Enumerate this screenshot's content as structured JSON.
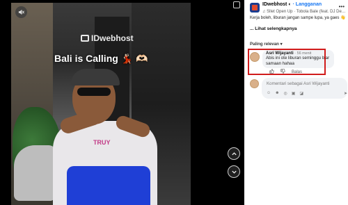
{
  "video": {
    "watermark": "IDwebhost",
    "caption": "Bali is Calling 💃🏻 🫶🏻",
    "shirt_print": "TRUY"
  },
  "controls": {
    "mute_icon": "volume-mute-icon",
    "prev_icon": "chevron-up-icon",
    "next_icon": "chevron-down-icon",
    "collapse_icon": "collapse-panel-icon"
  },
  "page": {
    "name": "IDwebhost",
    "subscribe_label": "· Langganan",
    "track": "♫ Sllet Open Up · Tobola Bale (feat. DJ De…",
    "post_text": "Kerja boleh, liburan jangan sampe lupa, ya gaes 👋",
    "see_more": "... Lihat selengkapnya"
  },
  "comments": {
    "sort_label": "Paling relevan ▾",
    "items": [
      {
        "author": "Asri Wijayanti",
        "time": "· 56 menit",
        "text": "Abis ini ote liburan seminggu biar samaan hahaa",
        "actions": {
          "reply": "Balas"
        }
      }
    ],
    "reply_placeholder": "Komentari sebagai Asri Wijayanti"
  }
}
